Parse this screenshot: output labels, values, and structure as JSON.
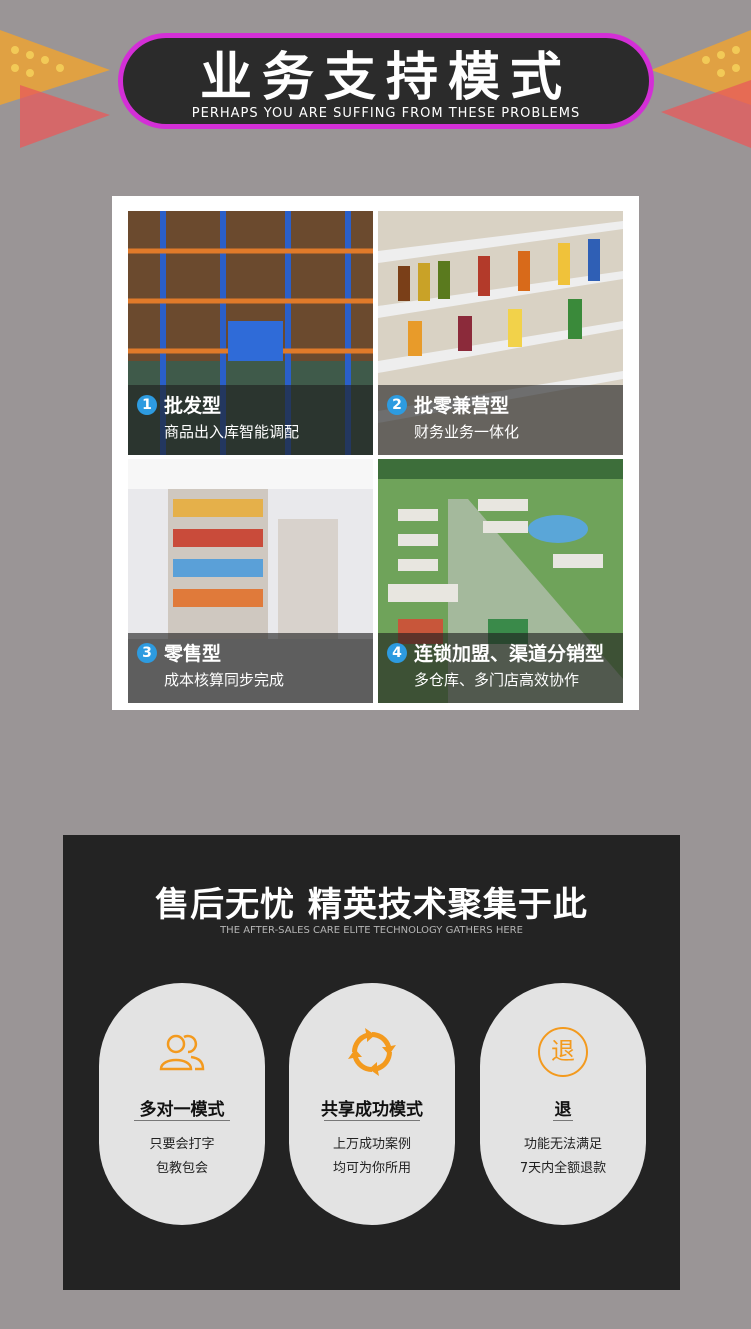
{
  "banner": {
    "title": "业务支持模式",
    "subtitle": "PERHAPS YOU ARE SUFFING FROM THESE PROBLEMS"
  },
  "modes": [
    {
      "num": "1",
      "title": "批发型",
      "desc": "商品出入库智能调配"
    },
    {
      "num": "2",
      "title": "批零兼营型",
      "desc": "财务业务一体化"
    },
    {
      "num": "3",
      "title": "零售型",
      "desc": "成本核算同步完成"
    },
    {
      "num": "4",
      "title": "连锁加盟、渠道分销型",
      "desc": "多仓库、多门店高效协作"
    }
  ],
  "after_sales": {
    "title": "售后无忧 精英技术聚集于此",
    "subtitle": "THE AFTER-SALES CARE ELITE TECHNOLOGY GATHERS HERE",
    "cards": [
      {
        "icon": "people-icon",
        "title": "多对一模式",
        "line1": "只要会打字",
        "line2": "包教包会"
      },
      {
        "icon": "refresh-arrows-icon",
        "title": "共享成功模式",
        "line1": "上万成功案例",
        "line2": "均可为你所用"
      },
      {
        "icon": "refund-icon",
        "icon_text": "退",
        "title": "退",
        "line1": "功能无法满足",
        "line2": "7天内全额退款"
      }
    ]
  },
  "colors": {
    "background": "#9a9596",
    "banner_border": "#d32fd6",
    "panel": "#232323",
    "card": "#e3e3e3",
    "accent_orange": "#f39a1e",
    "badge_blue": "#2d9be0"
  }
}
